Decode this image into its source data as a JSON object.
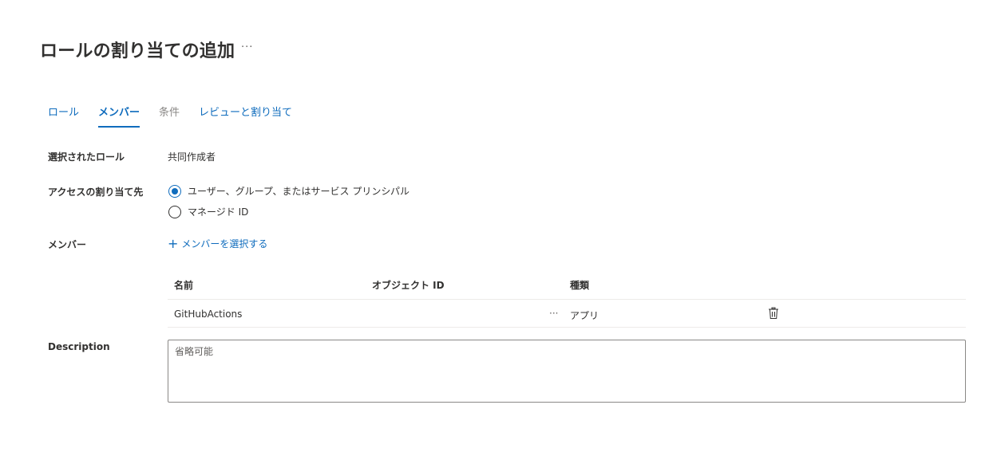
{
  "header": {
    "title": "ロールの割り当ての追加",
    "more": "···"
  },
  "tabs": [
    {
      "label": "ロール",
      "state": "link"
    },
    {
      "label": "メンバー",
      "state": "active"
    },
    {
      "label": "条件",
      "state": "disabled"
    },
    {
      "label": "レビューと割り当て",
      "state": "link"
    }
  ],
  "form": {
    "selected_role_label": "選択されたロール",
    "selected_role_value": "共同作成者",
    "assign_access_label": "アクセスの割り当て先",
    "assign_options": [
      {
        "label": "ユーザー、グループ、またはサービス プリンシパル",
        "checked": true
      },
      {
        "label": "マネージド ID",
        "checked": false
      }
    ],
    "members_label": "メンバー",
    "add_members_link": "メンバーを選択する",
    "description_label": "Description",
    "description_placeholder": "省略可能"
  },
  "members_table": {
    "columns": [
      "名前",
      "オブジェクト ID",
      "種類"
    ],
    "rows": [
      {
        "name": "GitHubActions",
        "object_id_more": "···",
        "type": "アプリ"
      }
    ]
  },
  "icons": {
    "delete": "trash-icon",
    "add": "plus-icon"
  },
  "colors": {
    "accent": "#0f6cbd",
    "text": "#323130",
    "disabled": "#8a8886",
    "border": "#edebe9"
  }
}
